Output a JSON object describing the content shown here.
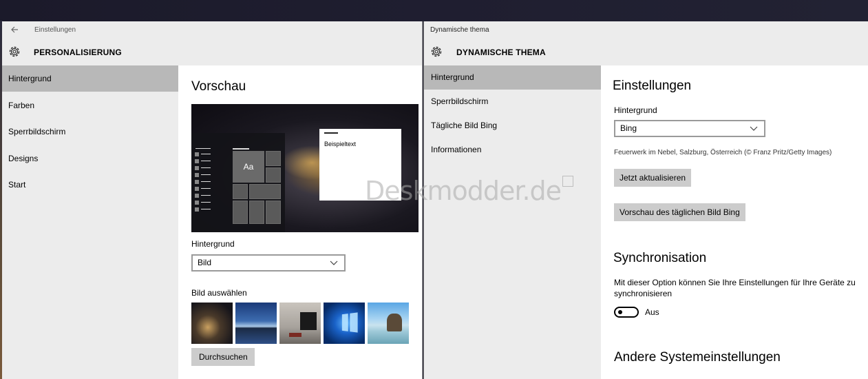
{
  "left_window": {
    "titlebar_title": "Einstellungen",
    "header_title": "PERSONALISIERUNG",
    "nav": [
      {
        "label": "Hintergrund",
        "selected": true
      },
      {
        "label": "Farben",
        "selected": false
      },
      {
        "label": "Sperrbildschirm",
        "selected": false
      },
      {
        "label": "Designs",
        "selected": false
      },
      {
        "label": "Start",
        "selected": false
      }
    ],
    "preview_title": "Vorschau",
    "preview_sample_text": "Beispieltext",
    "preview_tile_text": "Aa",
    "background_label": "Hintergrund",
    "background_value": "Bild",
    "choose_picture_label": "Bild auswählen",
    "browse_button": "Durchsuchen"
  },
  "right_window": {
    "titlebar_title": "Dynamische thema",
    "header_title": "DYNAMISCHE THEMA",
    "nav": [
      {
        "label": "Hintergrund",
        "selected": true
      },
      {
        "label": "Sperrbildschirm",
        "selected": false
      },
      {
        "label": "Tägliche Bild Bing",
        "selected": false
      },
      {
        "label": "Informationen",
        "selected": false
      }
    ],
    "settings_title": "Einstellungen",
    "background_label": "Hintergrund",
    "background_value": "Bing",
    "image_caption": "Feuerwerk im Nebel, Salzburg, Österreich (© Franz Pritz/Getty Images)",
    "update_button": "Jetzt aktualisieren",
    "preview_button": "Vorschau des täglichen Bild Bing",
    "sync_title": "Synchronisation",
    "sync_description_line1": "Mit dieser Option können Sie Ihre Einstellungen für Ihre Geräte zu",
    "sync_description_line2": "synchronisieren",
    "sync_toggle_state": "Aus",
    "other_settings_title": "Andere Systemeinstellungen"
  },
  "watermark": "Deskmodder.de",
  "colors": {
    "sidebar_bg": "#ececec",
    "selected_nav_bg": "#b8b8b8",
    "button_bg": "#cccccc"
  }
}
